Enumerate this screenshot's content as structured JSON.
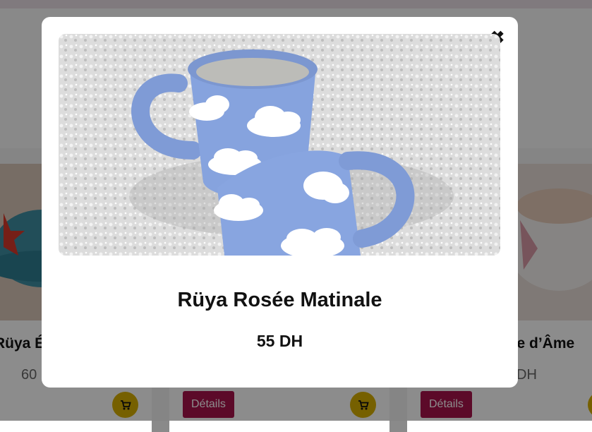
{
  "background_page": {
    "cards": [
      {
        "title": "Rüya Ét",
        "price": "60"
      },
      {
        "title": "",
        "price": "",
        "details_label": "Détails"
      },
      {
        "title": "age d’Âme",
        "price": "DH",
        "details_label": "Détails"
      }
    ]
  },
  "modal": {
    "close_icon": "close-icon",
    "product_name": "Rüya Rosée Matinale",
    "price": "55 DH",
    "image_subject": "two blue ceramic mugs with white clouds"
  },
  "colors": {
    "details_button": "#a8134c",
    "cart_button": "#d8b000",
    "overlay": "rgba(0,0,0,0.45)"
  }
}
